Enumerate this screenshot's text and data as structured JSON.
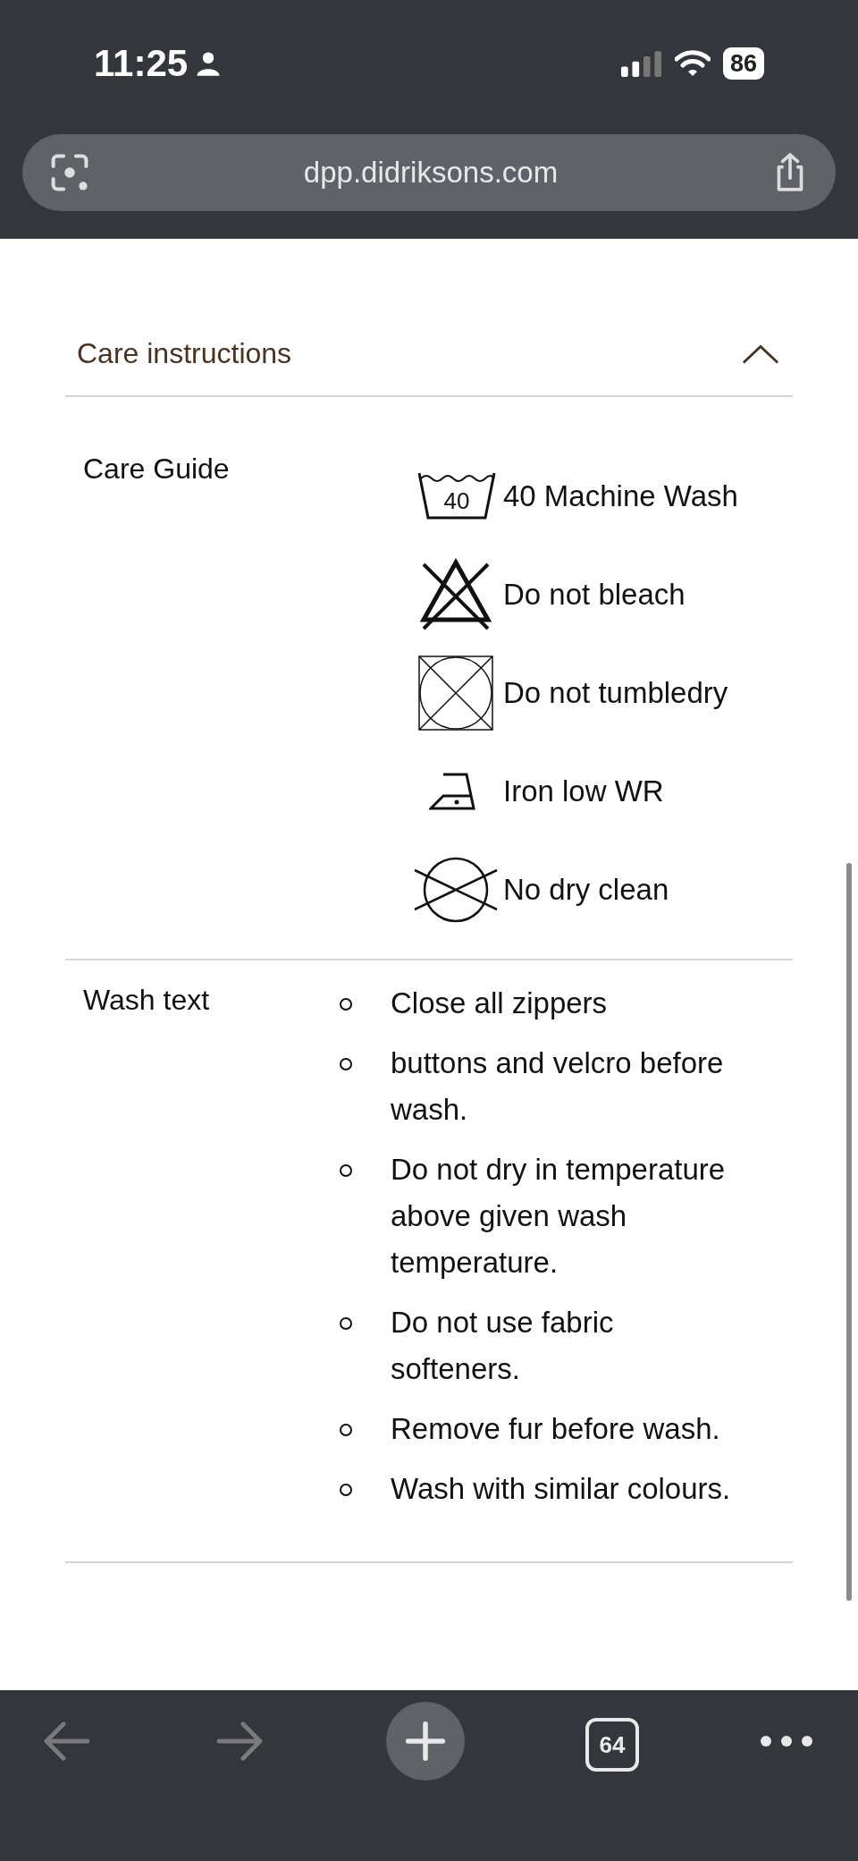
{
  "status_bar": {
    "time": "11:25",
    "battery": "86"
  },
  "address_bar": {
    "url": "dpp.didriksons.com"
  },
  "section": {
    "title": "Care instructions",
    "expanded": true
  },
  "care_guide": {
    "label": "Care Guide",
    "items": [
      {
        "kind": "wash",
        "temperature": "40",
        "text": "40 Machine Wash"
      },
      {
        "kind": "no-bleach",
        "text": "Do not bleach"
      },
      {
        "kind": "no-tumble-dry",
        "text": "Do not tumbledry"
      },
      {
        "kind": "iron-low",
        "text": "Iron low WR"
      },
      {
        "kind": "no-dry-clean",
        "text": "No dry clean"
      }
    ]
  },
  "wash_text": {
    "label": "Wash text",
    "items": [
      "Close all zippers",
      "buttons and velcro before wash.",
      "Do not dry in temperature above given wash temperature.",
      "Do not use fabric softeners.",
      "Remove fur before wash.",
      "Wash with similar colours."
    ]
  },
  "toolbar": [
    {
      "kind": "back",
      "disabled": true
    },
    {
      "kind": "forward",
      "disabled": true
    },
    {
      "kind": "new-tab",
      "disabled": false
    },
    {
      "kind": "tabs",
      "label": "64",
      "disabled": false
    },
    {
      "kind": "more",
      "disabled": false
    }
  ]
}
